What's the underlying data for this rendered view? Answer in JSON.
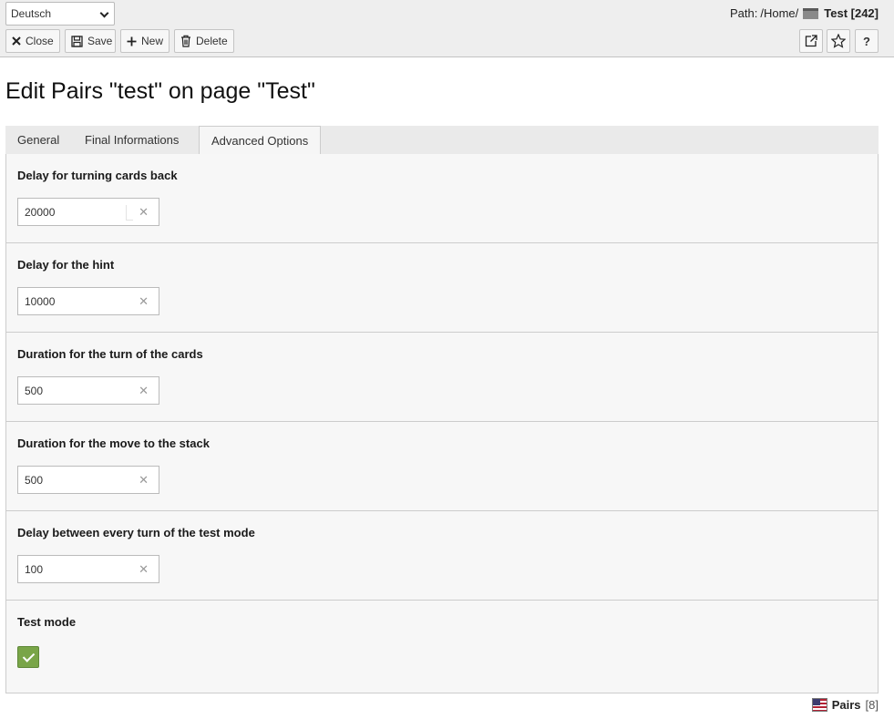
{
  "header": {
    "language": "Deutsch",
    "path_label": "Path:",
    "path_home": "/Home/",
    "path_page": "Test [242]",
    "buttons": {
      "close": "Close",
      "save": "Save",
      "new": "New",
      "delete": "Delete",
      "help": "?"
    }
  },
  "title": "Edit Pairs \"test\" on page \"Test\"",
  "tabs": [
    "General",
    "Final Informations",
    "Advanced Options"
  ],
  "active_tab": "Advanced Options",
  "fields": [
    {
      "label": "Delay for turning cards back",
      "value": "20000"
    },
    {
      "label": "Delay for the hint",
      "value": "10000"
    },
    {
      "label": "Duration for the turn of the cards",
      "value": "500"
    },
    {
      "label": "Duration for the move to the stack",
      "value": "500"
    },
    {
      "label": "Delay between every turn of the test mode",
      "value": "100"
    },
    {
      "label": "Test mode",
      "checked": true
    }
  ],
  "footer": {
    "record_name": "Pairs",
    "record_count": "[8]"
  },
  "colors": {
    "header_bg": "#eeeeee",
    "checkbox_green": "#79a548",
    "panel_bg": "#f7f7f7"
  }
}
